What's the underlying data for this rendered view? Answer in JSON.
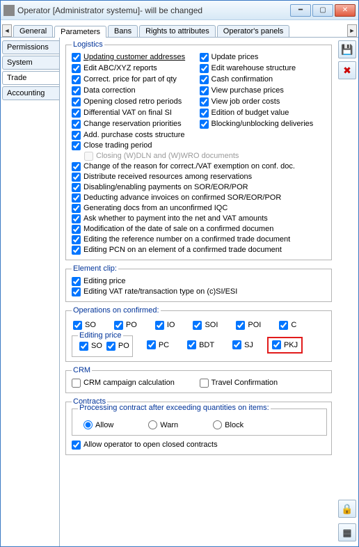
{
  "window": {
    "title": "Operator [Administrator systemu]- will be changed"
  },
  "tabs": {
    "general": "General",
    "parameters": "Parameters",
    "bans": "Bans",
    "rights": "Rights to attributes",
    "panels": "Operator's panels"
  },
  "vtabs": {
    "permissions": "Permissions",
    "system": "System",
    "trade": "Trade",
    "accounting": "Accounting"
  },
  "logistics": {
    "legend": "Logistics",
    "leftcol": [
      "Updating customer addresses",
      "Edit ABC/XYZ reports",
      "Correct. price for part of qty",
      "Data correction",
      "Opening closed retro periods",
      "Differential VAT on final SI",
      "Change reservation priorities"
    ],
    "rightcol": [
      "Update prices",
      "Edit warehouse structure",
      "Cash confirmation",
      "View purchase prices",
      "View job order costs",
      "Edition of budget value",
      "Blocking/unblocking deliveries"
    ],
    "fullrows": [
      "Add. purchase costs structure",
      "Close trading period"
    ],
    "disabled_row": "Closing (W)DLN and (W)WRO documents",
    "fullrows2": [
      "Change of the reason for correct./VAT exemption on conf. doc.",
      "Distribute received resources among reservations",
      "Disabling/enabling payments on SOR/EOR/POR",
      "Deducting advance invoices on confirmed SOR/EOR/POR",
      "Generating docs from an unconfirmed IQC",
      "Ask whether to payment into the net and VAT amounts",
      "Modification of the date of sale on a confirmed documen",
      "Editing the reference number on a confirmed trade document",
      "Editing PCN on an element of a confirmed trade document"
    ]
  },
  "element_clip": {
    "legend": "Element clip:",
    "items": [
      "Editing price",
      "Editing VAT rate/transaction type on (c)SI/ESI"
    ]
  },
  "ops_confirmed": {
    "legend": "Operations on confirmed:",
    "row1": [
      "SO",
      "PO",
      "IO",
      "SOI",
      "POI",
      "C"
    ],
    "editing_price_label": "Editing price",
    "row2_inbox": [
      "SO",
      "PO"
    ],
    "row2_outer": [
      "PC",
      "BDT",
      "SJ"
    ],
    "pkj": "PKJ"
  },
  "crm": {
    "legend": "CRM",
    "items": [
      "CRM campaign calculation",
      "Travel Confirmation"
    ]
  },
  "contracts": {
    "legend": "Contracts",
    "processing_label": "Processing contract after exceeding quantities on items:",
    "radios": [
      "Allow",
      "Warn",
      "Block"
    ],
    "allow_open": "Allow operator to open closed contracts"
  },
  "tools": {
    "save": "save",
    "delete": "delete",
    "lock": "lock",
    "other": "other"
  }
}
